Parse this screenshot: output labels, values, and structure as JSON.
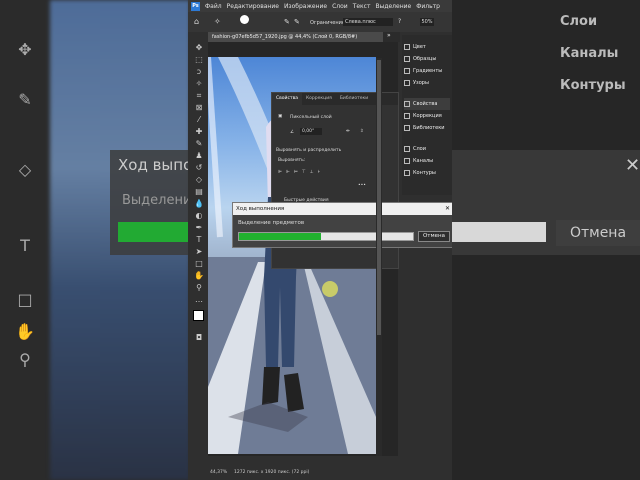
{
  "app": {
    "logo": "Ps"
  },
  "menu": [
    "Файл",
    "Редактирование",
    "Изображение",
    "Слои",
    "Текст",
    "Выделение",
    "Фильтр"
  ],
  "options": {
    "constraint": "Ограничение:",
    "mode": "Слева.плюс",
    "zoom": "50%"
  },
  "document": {
    "tab": "fashion-g07efb5d57_1920.jpg @ 44,4% (Слой 0, RGB/8#)",
    "zoom_status": "44,37%",
    "size_status": "1272 пикс. x 1920 пикс. (72 ppi)"
  },
  "panels": {
    "top_group": [
      "Цвет",
      "Образцы",
      "Градиенты",
      "Узоры"
    ],
    "middle_group": [
      "Свойства",
      "Коррекция",
      "Библиотеки"
    ],
    "bottom_group": [
      "Слои",
      "Каналы",
      "Контуры"
    ]
  },
  "properties": {
    "tabs": [
      "Свойства",
      "Коррекция",
      "Библиотеки"
    ],
    "layer_type": "Пиксельный слой",
    "angle": "0,00°",
    "section_align": "Выровнять и распределить",
    "align_label": "Выровнять:",
    "quick_actions": "Быстрые действия"
  },
  "progress_dialog": {
    "title": "Ход выполнения",
    "label": "Выделение предметов",
    "progress": 0.47,
    "cancel": "Отмена"
  },
  "background_blur": {
    "title": "Ход выпол",
    "text": "Выделени",
    "cancel": "Отмена",
    "panels": [
      "Слои",
      "Каналы",
      "Контуры"
    ]
  },
  "colors": {
    "accent": "#2d7ad6",
    "progress": "#21b12f"
  }
}
